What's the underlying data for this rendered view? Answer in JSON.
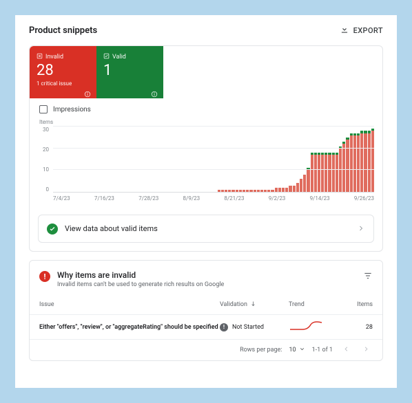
{
  "header": {
    "title": "Product snippets",
    "export_label": "EXPORT"
  },
  "summary": {
    "invalid": {
      "label": "Invalid",
      "value": "28",
      "sub": "1 critical issue"
    },
    "valid": {
      "label": "Valid",
      "value": "1"
    },
    "impressions_label": "Impressions"
  },
  "chart_data": {
    "type": "bar",
    "ylabel": "Items",
    "ylim": [
      0,
      30
    ],
    "yticks": [
      0,
      10,
      20,
      30
    ],
    "xticks": [
      "7/4/23",
      "7/16/23",
      "7/28/23",
      "8/9/23",
      "8/21/23",
      "9/2/23",
      "9/14/23",
      "9/26/23"
    ],
    "categories": [
      "7/4/23",
      "7/5/23",
      "7/6/23",
      "7/7/23",
      "7/8/23",
      "7/9/23",
      "7/10/23",
      "7/11/23",
      "7/12/23",
      "7/13/23",
      "7/14/23",
      "7/15/23",
      "7/16/23",
      "7/17/23",
      "7/18/23",
      "7/19/23",
      "7/20/23",
      "7/21/23",
      "7/22/23",
      "7/23/23",
      "7/24/23",
      "7/25/23",
      "7/26/23",
      "7/27/23",
      "7/28/23",
      "7/29/23",
      "7/30/23",
      "7/31/23",
      "8/1/23",
      "8/2/23",
      "8/3/23",
      "8/4/23",
      "8/5/23",
      "8/6/23",
      "8/7/23",
      "8/8/23",
      "8/9/23",
      "8/10/23",
      "8/11/23",
      "8/12/23",
      "8/13/23",
      "8/14/23",
      "8/15/23",
      "8/16/23",
      "8/17/23",
      "8/18/23",
      "8/19/23",
      "8/20/23",
      "8/21/23",
      "8/22/23",
      "8/23/23",
      "8/24/23",
      "8/25/23",
      "8/26/23",
      "8/27/23",
      "8/28/23",
      "8/29/23",
      "8/30/23",
      "8/31/23",
      "9/1/23",
      "9/2/23",
      "9/3/23",
      "9/4/23",
      "9/5/23",
      "9/6/23",
      "9/7/23",
      "9/8/23",
      "9/9/23",
      "9/10/23",
      "9/11/23",
      "9/12/23",
      "9/13/23",
      "9/14/23",
      "9/15/23",
      "9/16/23",
      "9/17/23",
      "9/18/23",
      "9/19/23",
      "9/20/23",
      "9/21/23",
      "9/22/23",
      "9/23/23",
      "9/24/23",
      "9/25/23",
      "9/26/23",
      "9/27/23",
      "9/28/23",
      "9/29/23",
      "9/30/23",
      "10/1/23"
    ],
    "series": [
      {
        "name": "Invalid",
        "color": "#e06c5e",
        "values": [
          0,
          0,
          0,
          0,
          0,
          0,
          0,
          0,
          0,
          0,
          0,
          0,
          0,
          0,
          0,
          0,
          0,
          0,
          0,
          0,
          0,
          0,
          0,
          0,
          0,
          0,
          0,
          0,
          0,
          0,
          0,
          0,
          0,
          0,
          0,
          0,
          0,
          0,
          0,
          0,
          0,
          0,
          0,
          0,
          0,
          0,
          1,
          1,
          1,
          1,
          1,
          1,
          1,
          1,
          1,
          1,
          1,
          1,
          1,
          1,
          1,
          1,
          2,
          2,
          2,
          2,
          3,
          3,
          4,
          6,
          8,
          10,
          17,
          17,
          17,
          17,
          17,
          17,
          17,
          17,
          20,
          22,
          24,
          26,
          26,
          26,
          27,
          27,
          27,
          28
        ]
      },
      {
        "name": "Valid",
        "color": "#1e8e3e",
        "values": [
          0,
          0,
          0,
          0,
          0,
          0,
          0,
          0,
          0,
          0,
          0,
          0,
          0,
          0,
          0,
          0,
          0,
          0,
          0,
          0,
          0,
          0,
          0,
          0,
          0,
          0,
          0,
          0,
          0,
          0,
          0,
          0,
          0,
          0,
          0,
          0,
          0,
          0,
          0,
          0,
          0,
          0,
          0,
          0,
          0,
          0,
          0,
          0,
          0,
          0,
          0,
          0,
          0,
          0,
          0,
          0,
          0,
          0,
          0,
          0,
          0,
          0,
          0,
          0,
          0,
          0,
          0,
          0,
          0,
          0,
          0,
          1,
          1,
          1,
          1,
          1,
          1,
          1,
          1,
          1,
          1,
          1,
          1,
          1,
          1,
          1,
          1,
          1,
          1,
          1
        ]
      }
    ]
  },
  "valid_link_label": "View data about valid items",
  "issues": {
    "title": "Why items are invalid",
    "subtitle": "Invalid items can't be used to generate rich results on Google",
    "columns": {
      "issue": "Issue",
      "validation": "Validation",
      "trend": "Trend",
      "items": "Items"
    },
    "rows": [
      {
        "issue": "Either \"offers\", \"review\", or \"aggregateRating\" should be specified",
        "validation": "Not Started",
        "items": "28"
      }
    ],
    "pager": {
      "rows_per_page_label": "Rows per page:",
      "rows_per_page_value": "10",
      "range": "1-1 of 1"
    }
  }
}
